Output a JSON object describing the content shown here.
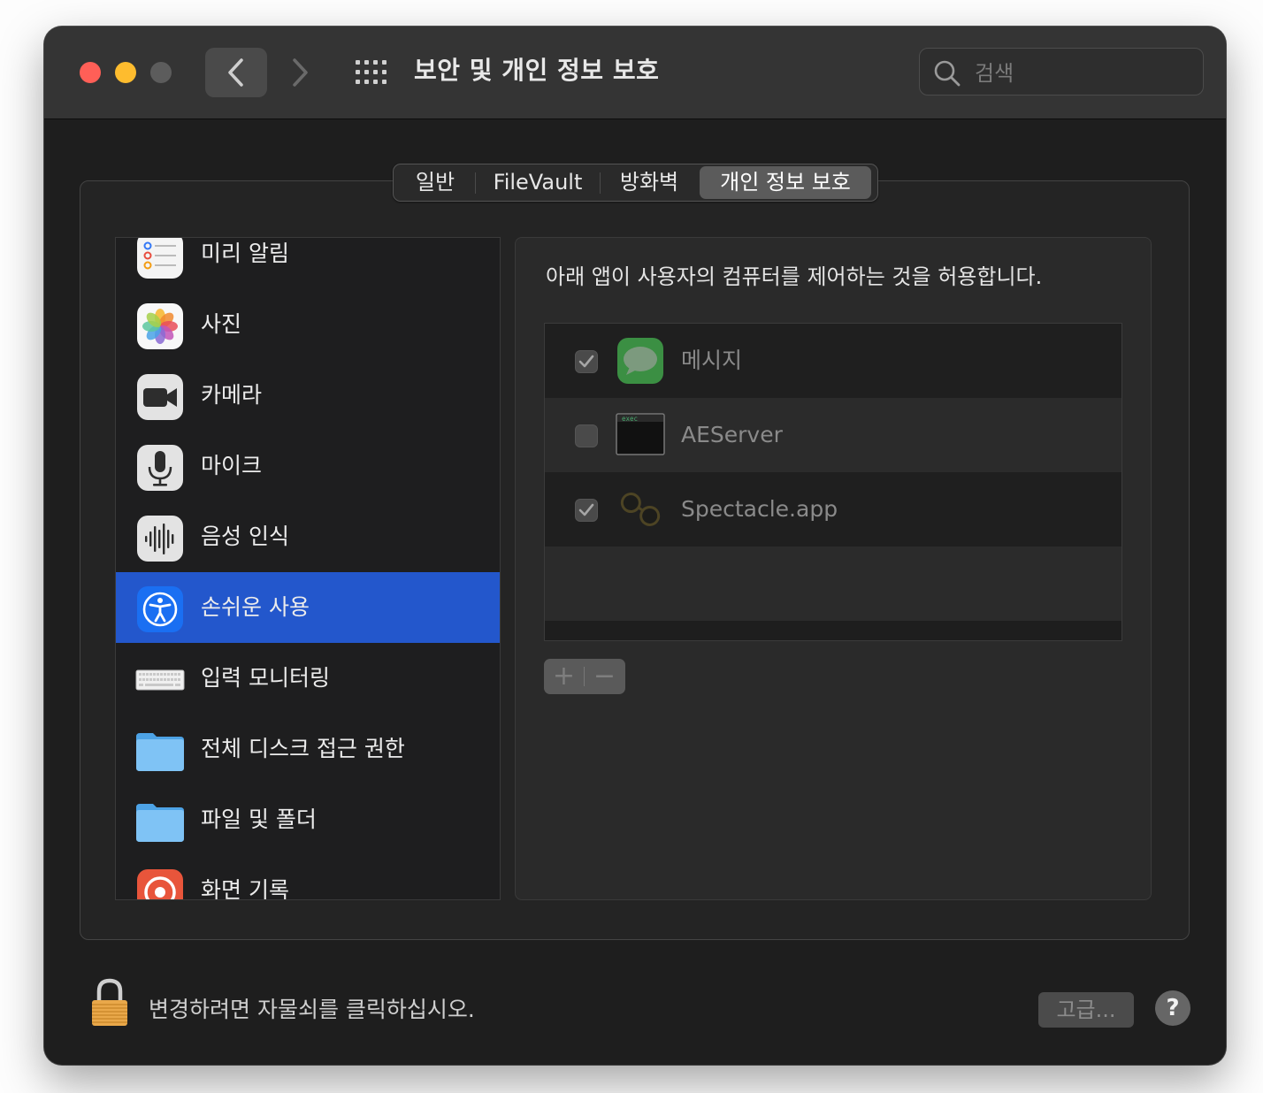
{
  "window": {
    "title": "보안 및 개인 정보 보호",
    "traffic_lights": {
      "close": "#ff5f57",
      "minimize": "#febc2e",
      "zoom": "#5c5c5c"
    }
  },
  "search": {
    "placeholder": "검색",
    "value": ""
  },
  "tabs": [
    {
      "label": "일반",
      "selected": false
    },
    {
      "label": "FileVault",
      "selected": false
    },
    {
      "label": "방화벽",
      "selected": false
    },
    {
      "label": "개인 정보 보호",
      "selected": true
    }
  ],
  "sidebar": {
    "items": [
      {
        "label": "미리 알림",
        "icon": "reminders-icon"
      },
      {
        "label": "사진",
        "icon": "photos-icon"
      },
      {
        "label": "카메라",
        "icon": "camera-icon"
      },
      {
        "label": "마이크",
        "icon": "microphone-icon"
      },
      {
        "label": "음성 인식",
        "icon": "speech-recognition-icon"
      },
      {
        "label": "손쉬운 사용",
        "icon": "accessibility-icon",
        "selected": true
      },
      {
        "label": "입력 모니터링",
        "icon": "keyboard-icon"
      },
      {
        "label": "전체 디스크 접근 권한",
        "icon": "folder-icon"
      },
      {
        "label": "파일 및 폴더",
        "icon": "folder-icon"
      },
      {
        "label": "화면 기록",
        "icon": "screen-recording-icon"
      }
    ],
    "selected_color": "#2357cc"
  },
  "main": {
    "description": "아래 앱이 사용자의 컴퓨터를 제어하는 것을 허용합니다.",
    "apps": [
      {
        "name": "메시지",
        "checked": true,
        "icon": "messages-icon"
      },
      {
        "name": "AEServer",
        "checked": false,
        "icon": "terminal-exec-icon",
        "icon_text": "exec"
      },
      {
        "name": "Spectacle.app",
        "checked": true,
        "icon": "spectacle-icon"
      }
    ],
    "add_label": "+",
    "remove_label": "−"
  },
  "footer": {
    "lock_text": "변경하려면 자물쇠를 클릭하십시오.",
    "advanced_label": "고급...",
    "help_label": "?"
  }
}
